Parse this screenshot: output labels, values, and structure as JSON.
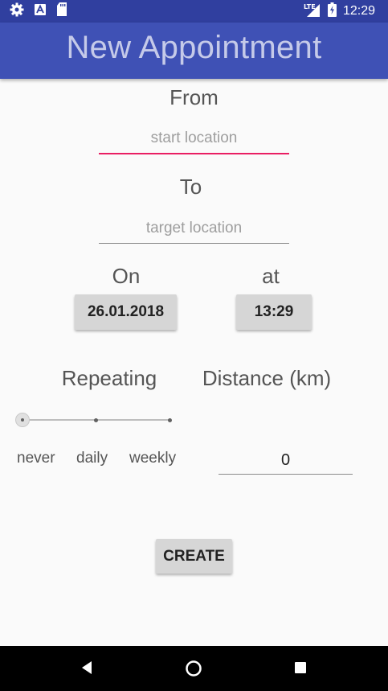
{
  "status_bar": {
    "time": "12:29",
    "network": "LTE",
    "icons": [
      "settings-icon",
      "a-notification-icon",
      "sd-card-icon",
      "signal-icon",
      "battery-icon"
    ]
  },
  "app_bar": {
    "title": "New Appointment",
    "color": "#3f51b5"
  },
  "form": {
    "from_label": "From",
    "start_placeholder": "start location",
    "to_label": "To",
    "target_placeholder": "target location",
    "on_label": "On",
    "date_value": "26.01.2018",
    "at_label": "at",
    "time_value": "13:29",
    "repeating_label": "Repeating",
    "distance_label": "Distance (km)",
    "repeat_options": [
      "never",
      "daily",
      "weekly"
    ],
    "repeat_selected": "never",
    "distance_value": "0",
    "create_label": "CREATE",
    "accent_color": "#e91e63"
  },
  "nav_bar": {
    "buttons": [
      "back-icon",
      "home-icon",
      "recents-icon"
    ]
  }
}
